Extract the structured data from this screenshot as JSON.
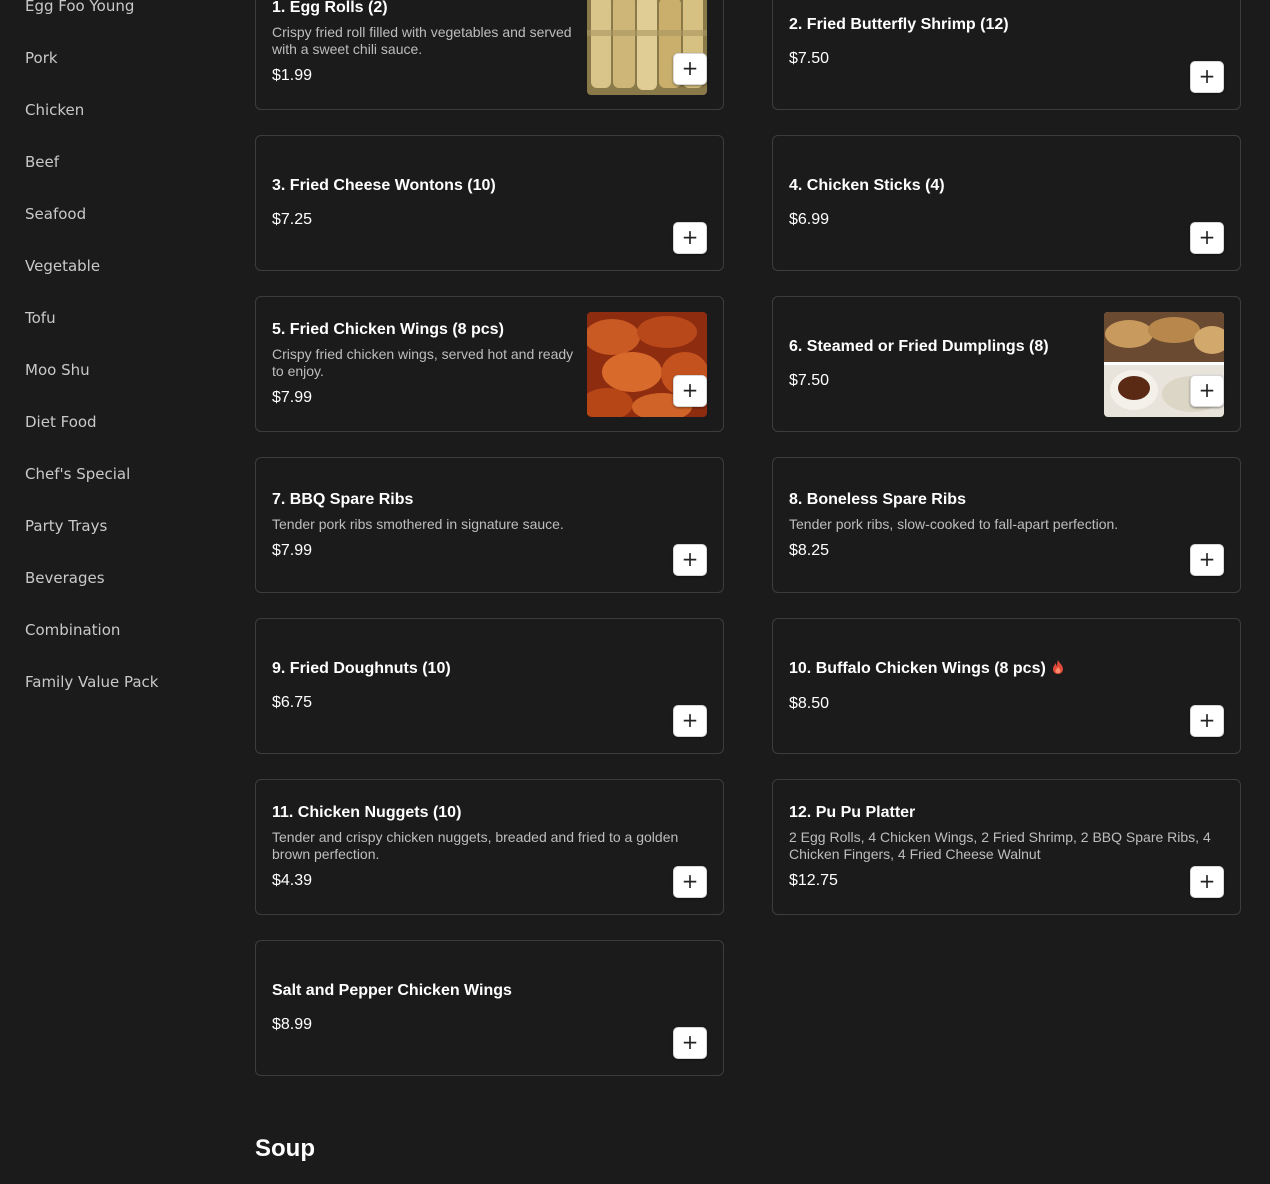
{
  "sidebar": {
    "items": [
      {
        "label": "Egg Foo Young"
      },
      {
        "label": "Pork"
      },
      {
        "label": "Chicken"
      },
      {
        "label": "Beef"
      },
      {
        "label": "Seafood"
      },
      {
        "label": "Vegetable"
      },
      {
        "label": "Tofu"
      },
      {
        "label": "Moo Shu"
      },
      {
        "label": "Diet Food"
      },
      {
        "label": "Chef's Special"
      },
      {
        "label": "Party Trays"
      },
      {
        "label": "Beverages"
      },
      {
        "label": "Combination"
      },
      {
        "label": "Family Value Pack"
      }
    ]
  },
  "menu": {
    "add_label": "+",
    "items": [
      {
        "title": "1. Egg Rolls (2)",
        "desc": "Crispy fried roll filled with vegetables and served with a sweet chili sauce.",
        "price": "$1.99",
        "image": "egg-rolls-photo"
      },
      {
        "title": "2. Fried Butterfly Shrimp (12)",
        "desc": "",
        "price": "$7.50"
      },
      {
        "title": "3. Fried Cheese Wontons (10)",
        "desc": "",
        "price": "$7.25"
      },
      {
        "title": "4. Chicken Sticks (4)",
        "desc": "",
        "price": "$6.99"
      },
      {
        "title": "5. Fried Chicken Wings (8 pcs)",
        "desc": "Crispy fried chicken wings, served hot and ready to enjoy.",
        "price": "$7.99",
        "image": "chicken-wings-photo"
      },
      {
        "title": "6. Steamed or Fried Dumplings (8)",
        "desc": "",
        "price": "$7.50",
        "image": "dumplings-photo"
      },
      {
        "title": "7. BBQ Spare Ribs",
        "desc": "Tender pork ribs smothered in signature sauce.",
        "price": "$7.99"
      },
      {
        "title": "8. Boneless Spare Ribs",
        "desc": "Tender pork ribs, slow-cooked to fall-apart perfection.",
        "price": "$8.25"
      },
      {
        "title": "9. Fried Doughnuts (10)",
        "desc": "",
        "price": "$6.75"
      },
      {
        "title": "10. Buffalo Chicken Wings (8 pcs)",
        "desc": "",
        "price": "$8.50",
        "spicy": true
      },
      {
        "title": "11. Chicken Nuggets (10)",
        "desc": "Tender and crispy chicken nuggets, breaded and fried to a golden brown perfection.",
        "price": "$4.39"
      },
      {
        "title": "12. Pu Pu Platter",
        "desc": "2 Egg Rolls, 4 Chicken Wings, 2 Fried Shrimp, 2 BBQ Spare Ribs, 4 Chicken Fingers, 4 Fried Cheese Walnut",
        "price": "$12.75"
      },
      {
        "title": "Salt and Pepper Chicken Wings",
        "desc": "",
        "price": "$8.99"
      }
    ]
  },
  "next_section": {
    "title": "Soup"
  },
  "colors": {
    "background": "#1b1b1b",
    "card_border": "#3d3d3d",
    "spicy": "#e04a3a"
  }
}
